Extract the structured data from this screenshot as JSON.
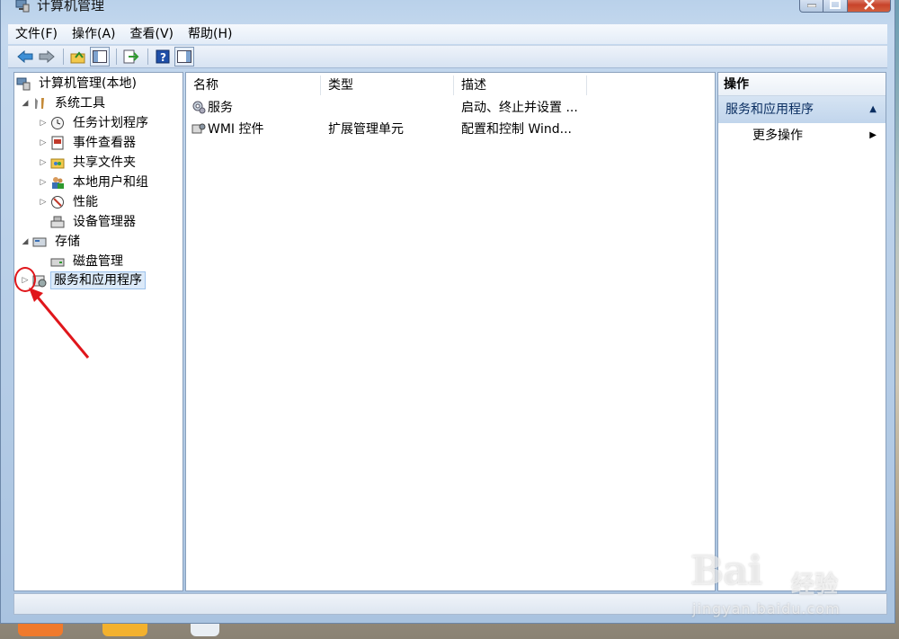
{
  "window": {
    "title": "计算机管理"
  },
  "menu": [
    "文件(F)",
    "操作(A)",
    "查看(V)",
    "帮助(H)"
  ],
  "toolbar": {
    "icons": [
      "back-arrow-icon",
      "forward-arrow-icon",
      "up-folder-icon",
      "show-hide-tree-icon",
      "export-list-icon",
      "help-icon",
      "show-hide-action-pane-icon"
    ]
  },
  "tree": {
    "root": "计算机管理(本地)",
    "system_tools": "系统工具",
    "task_scheduler": "任务计划程序",
    "event_viewer": "事件查看器",
    "shared_folders": "共享文件夹",
    "local_users": "本地用户和组",
    "performance": "性能",
    "device_manager": "设备管理器",
    "storage": "存储",
    "disk_management": "磁盘管理",
    "services_apps": "服务和应用程序"
  },
  "list": {
    "columns": [
      "名称",
      "类型",
      "描述"
    ],
    "rows": [
      {
        "name": "服务",
        "type": "",
        "desc": "启动、终止并设置 ..."
      },
      {
        "name": "WMI 控件",
        "type": "扩展管理单元",
        "desc": "配置和控制 Wind..."
      }
    ]
  },
  "actions": {
    "title": "操作",
    "section": "服务和应用程序",
    "more": "更多操作"
  },
  "watermark": {
    "main": "Bai",
    "sub": "经验",
    "url": "jingyan.baidu.com"
  },
  "colors": {
    "annotation": "#e0161b",
    "selection": "#dceaf9"
  }
}
